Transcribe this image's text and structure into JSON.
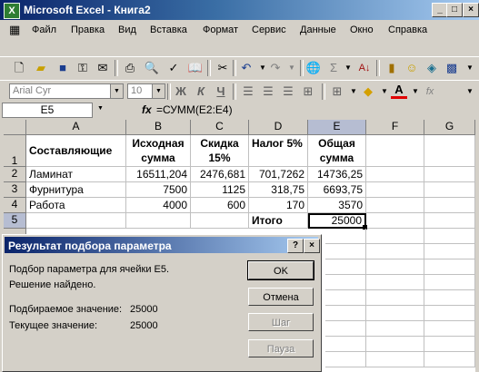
{
  "window": {
    "title": "Microsoft Excel - Книга2",
    "app_icon": "excel-icon"
  },
  "menu": {
    "items": [
      "Файл",
      "Правка",
      "Вид",
      "Вставка",
      "Формат",
      "Сервис",
      "Данные",
      "Окно",
      "Справка"
    ]
  },
  "toolbar": {
    "font_name": "Arial Cyr",
    "font_size": "10",
    "bold": "Ж",
    "italic": "К",
    "underline": "Ч",
    "autosum": "Σ",
    "function": "fx"
  },
  "formula_bar": {
    "name_box": "E5",
    "fx_label": "fx",
    "formula": "=СУММ(E2:E4)"
  },
  "grid": {
    "columns": [
      "A",
      "B",
      "C",
      "D",
      "E",
      "F",
      "G"
    ],
    "rows": [
      "1",
      "2",
      "3",
      "4",
      "5"
    ],
    "selected_cell": "E5",
    "cells": {
      "A1": "Составляющие",
      "B1": "Исходная сумма",
      "C1": "Скидка 15%",
      "D1": "Налог 5%",
      "E1": "Общая сумма",
      "A2": "Ламинат",
      "B2": "16511,204",
      "C2": "2476,681",
      "D2": "701,7262",
      "E2": "14736,25",
      "A3": "Фурнитура",
      "B3": "7500",
      "C3": "1125",
      "D3": "318,75",
      "E3": "6693,75",
      "A4": "Работа",
      "B4": "4000",
      "C4": "600",
      "D4": "170",
      "E4": "3570",
      "D5": "Итого",
      "E5": "25000"
    }
  },
  "dialog": {
    "title": "Результат подбора параметра",
    "help_btn": "?",
    "close_btn": "×",
    "line1": "Подбор параметра для ячейки E5.",
    "line2": "Решение найдено.",
    "target_label": "Подбираемое значение:",
    "target_value": "25000",
    "current_label": "Текущее значение:",
    "current_value": "25000",
    "buttons": {
      "ok": "OK",
      "cancel": "Отмена",
      "step": "Шаг",
      "pause": "Пауза"
    }
  }
}
